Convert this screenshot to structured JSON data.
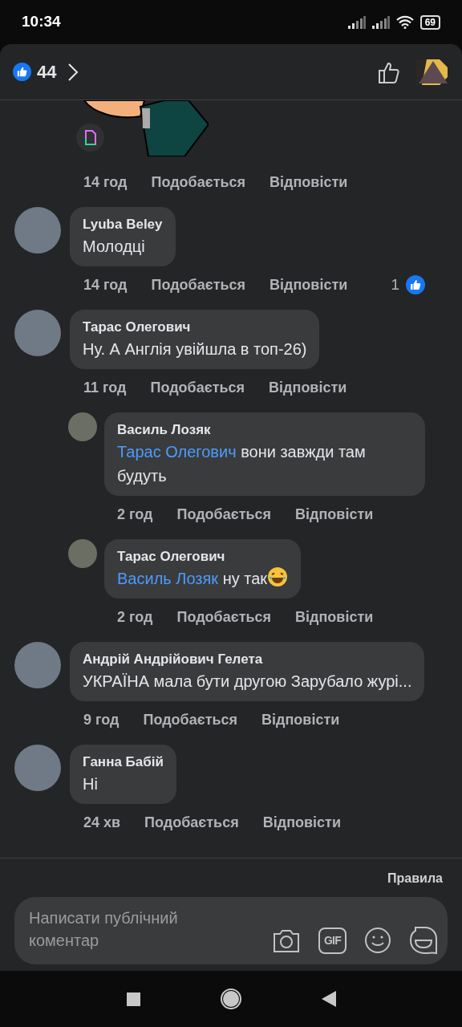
{
  "status_bar": {
    "time": "10:34",
    "battery": "69"
  },
  "header": {
    "reactions_count": "44"
  },
  "first_comment": {
    "time": "14 год",
    "like": "Подобається",
    "reply": "Відповісти"
  },
  "comments": [
    {
      "kind": "comment",
      "author": "Lyuba Beley",
      "text": "Молодці",
      "time": "14 год",
      "like": "Подобається",
      "reply": "Відповісти",
      "reaction_count": "1"
    },
    {
      "kind": "comment",
      "author": "Тарас Олегович",
      "text": "Ну. А Англія увійшла в топ-26)",
      "time": "11 год",
      "like": "Подобається",
      "reply": "Відповісти"
    },
    {
      "kind": "reply",
      "author": "Василь Лозяк",
      "mention": "Тарас Олегович",
      "text": "вони завжди там будуть",
      "time": "2 год",
      "like": "Подобається",
      "reply": "Відповісти"
    },
    {
      "kind": "reply",
      "author": "Тарас Олегович",
      "mention": "Василь Лозяк",
      "text": "ну так",
      "laughing_emoji": true,
      "time": "2 год",
      "like": "Подобається",
      "reply": "Відповісти"
    },
    {
      "kind": "comment",
      "author": "Андрій Андрійович Гелета",
      "text": "УКРАЇНА мала бути другою Зарубало журі...",
      "time": "9 год",
      "like": "Подобається",
      "reply": "Відповісти"
    },
    {
      "kind": "comment",
      "author": "Ганна Бабій",
      "text": "Ні",
      "time": "24 хв",
      "like": "Подобається",
      "reply": "Відповісти"
    }
  ],
  "footer": {
    "rules_link": "Правила",
    "comment_field": {
      "placeholder": "Написати публічний коментар"
    },
    "gif_label": "GIF"
  }
}
